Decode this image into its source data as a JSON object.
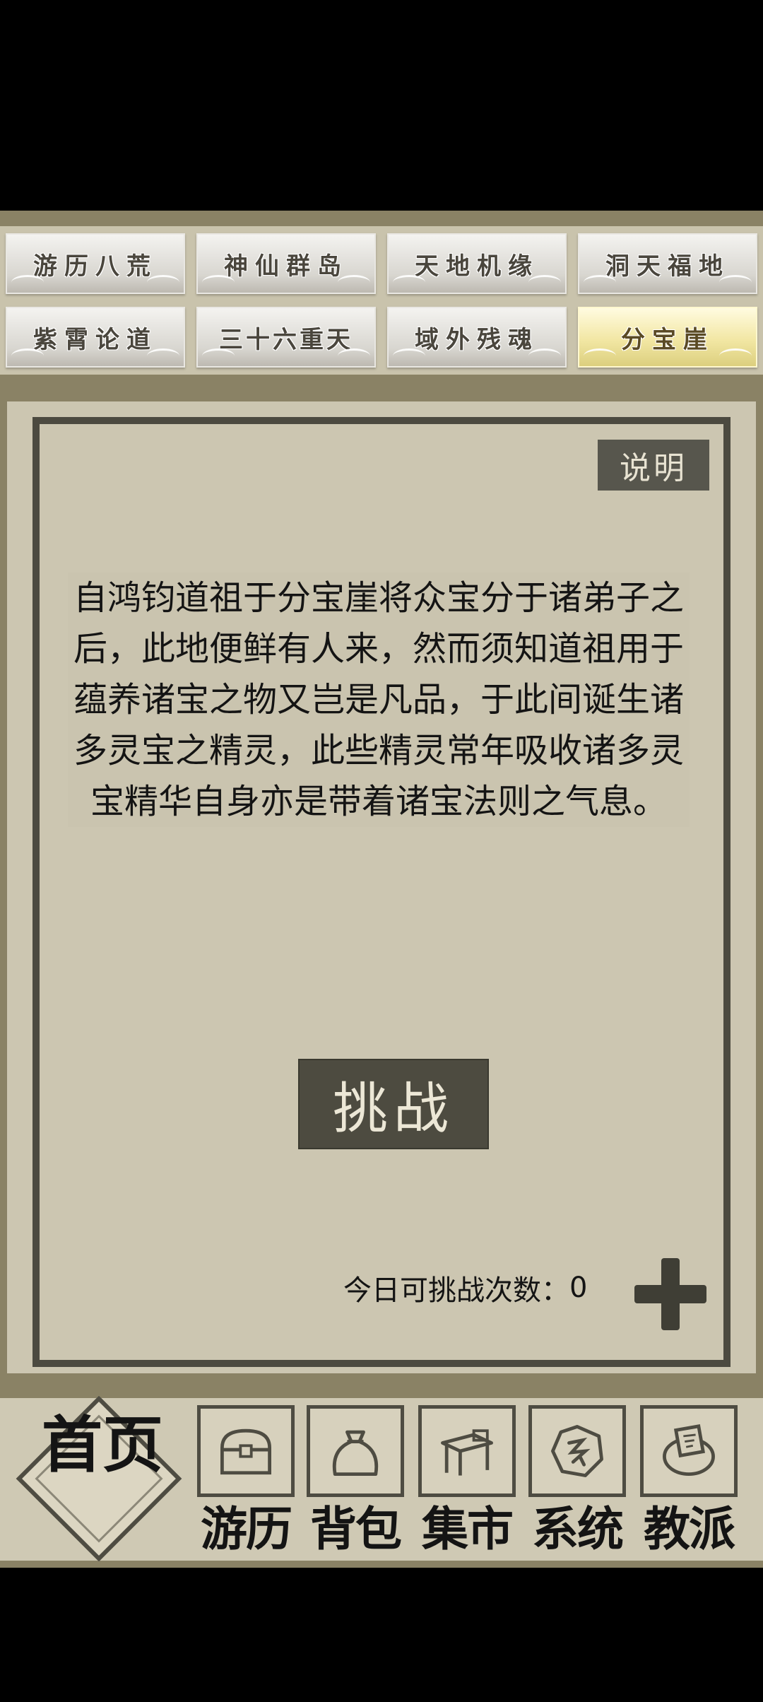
{
  "tabs": [
    {
      "label": "游历八荒",
      "active": false
    },
    {
      "label": "神仙群岛",
      "active": false
    },
    {
      "label": "天地机缘",
      "active": false
    },
    {
      "label": "洞天福地",
      "active": false
    },
    {
      "label": "紫霄论道",
      "active": false
    },
    {
      "label": "三十六重天",
      "active": false
    },
    {
      "label": "域外残魂",
      "active": false
    },
    {
      "label": "分宝崖",
      "active": true
    }
  ],
  "main": {
    "explain_label": "说明",
    "description": "自鸿钧道祖于分宝崖将众宝分于诸弟子之后，此地便鲜有人来，然而须知道祖用于蕴养诸宝之物又岂是凡品，于此间诞生诸多灵宝之精灵，此些精灵常年吸收诸多灵宝精华自身亦是带着诸宝法则之气息。",
    "challenge_label": "挑战",
    "count_label": "今日可挑战次数：",
    "count_value": "0"
  },
  "nav": {
    "home_label": "首页",
    "items": [
      {
        "label": "游历",
        "icon": "chest-icon"
      },
      {
        "label": "背包",
        "icon": "bag-icon"
      },
      {
        "label": "集市",
        "icon": "stall-icon"
      },
      {
        "label": "系统",
        "icon": "system-icon"
      },
      {
        "label": "教派",
        "icon": "sect-icon"
      }
    ]
  },
  "colors": {
    "panel": "#ccc6b1",
    "frame": "#4c4a40",
    "button": "#4d4b40",
    "active_tab": "#f2e7a4"
  }
}
